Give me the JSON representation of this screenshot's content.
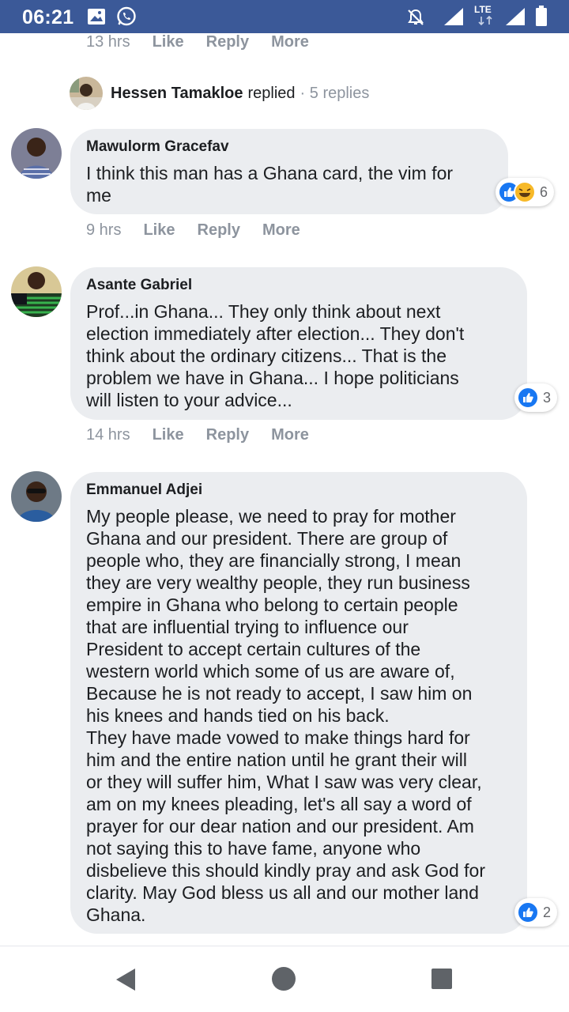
{
  "status_bar": {
    "time": "06:21",
    "network": "LTE"
  },
  "top_meta": {
    "time": "13 hrs",
    "like": "Like",
    "reply": "Reply",
    "more": "More"
  },
  "replied": {
    "name": "Hessen Tamakloe",
    "verb": "replied",
    "count": "· 5 replies"
  },
  "comments": [
    {
      "author": "Mawulorm Gracefav",
      "text": "I think this man has a Ghana card, the vim for\nme",
      "reactions": "6",
      "time": "9 hrs",
      "like": "Like",
      "reply": "Reply",
      "more": "More"
    },
    {
      "author": "Asante Gabriel",
      "text": "Prof...in Ghana... They only think about next\nelection immediately after election... They don't\nthink about the ordinary citizens... That is the\nproblem we have in Ghana... I hope politicians\nwill listen to your advice...",
      "reactions": "3",
      "time": "14 hrs",
      "like": "Like",
      "reply": "Reply",
      "more": "More"
    },
    {
      "author": "Emmanuel Adjei",
      "text": "My people please, we need to pray for mother\nGhana and our president. There are group of\npeople who, they are financially strong, I mean\nthey are very wealthy people, they run business\nempire in Ghana who belong to certain people\nthat are influential trying to influence our\nPresident to accept certain cultures of the\nwestern world which some of us are aware of,\nBecause he is not ready to accept, I saw him on\nhis knees and hands tied on his back.\nThey have made vowed to make things hard for\nhim and the entire nation until he grant their will\nor they will suffer him, What I saw was very clear,\nam on my knees pleading, let's all say a word of\nprayer for our dear nation and our president. Am\nnot saying this to have fame, anyone who\ndisbelieve this should kindly pray and ask God for\nclarity. May God bless us all and our mother land\nGhana.",
      "reactions": "2"
    }
  ],
  "colors": {
    "status_bar": "#3b5998",
    "bubble": "#ebedf0",
    "muted": "#8d949e",
    "like_blue": "#1877f2"
  }
}
